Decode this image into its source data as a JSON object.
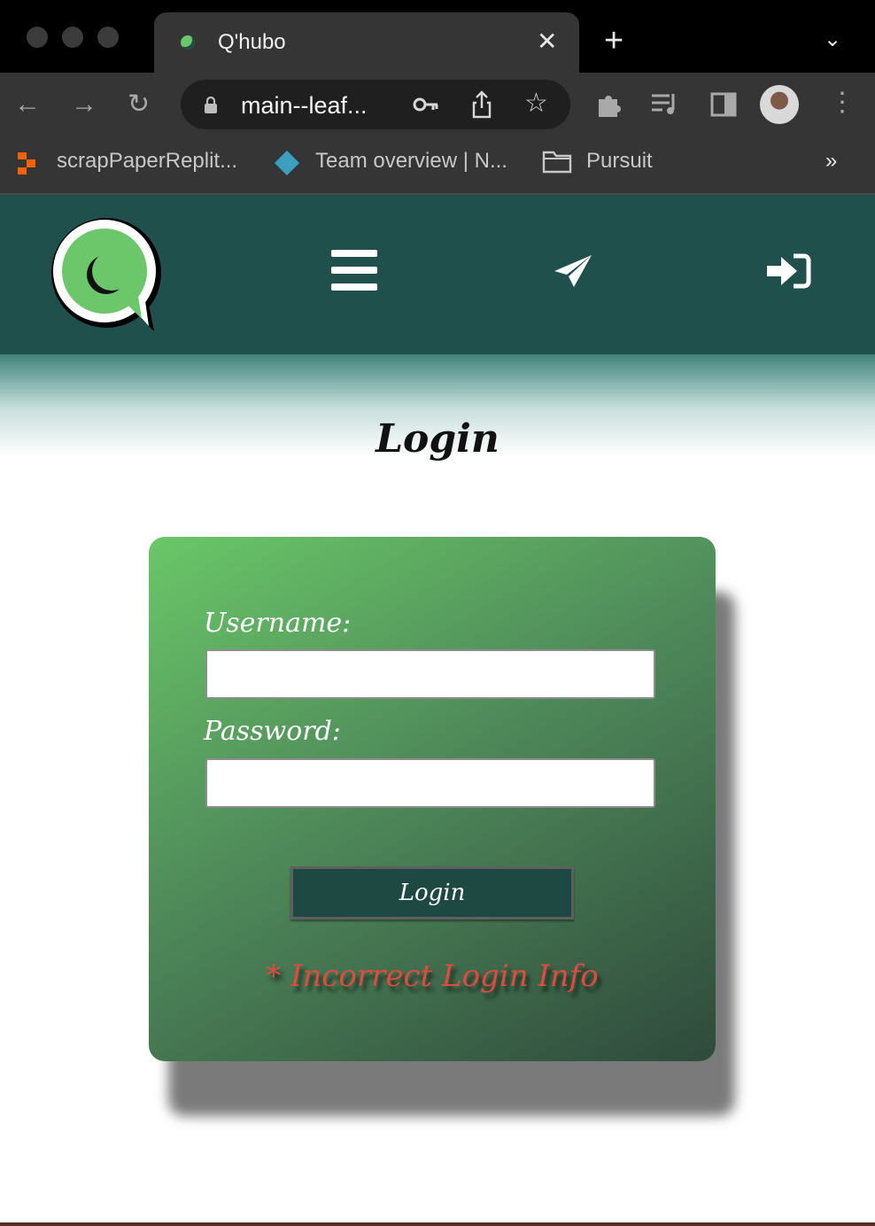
{
  "browser": {
    "tab_title": "Q'hubo",
    "url": "main--leaf...",
    "bookmarks": [
      {
        "label": "scrapPaperReplit...",
        "icon": "replit-icon"
      },
      {
        "label": "Team overview | N...",
        "icon": "diamond-icon"
      },
      {
        "label": "Pursuit",
        "icon": "folder-icon"
      }
    ],
    "more_bookmarks": "»"
  },
  "header": {
    "logo": "qhubo-chat-bubble-logo",
    "icons": [
      "menu-icon",
      "send-icon",
      "sign-in-icon"
    ],
    "bg_color": "#20504b"
  },
  "login": {
    "title": "Login",
    "username_label": "Username:",
    "password_label": "Password:",
    "username_value": "",
    "password_value": "",
    "button_label": "Login",
    "error_message": "* Incorrect Login Info",
    "error_color": "#e24a3f"
  }
}
